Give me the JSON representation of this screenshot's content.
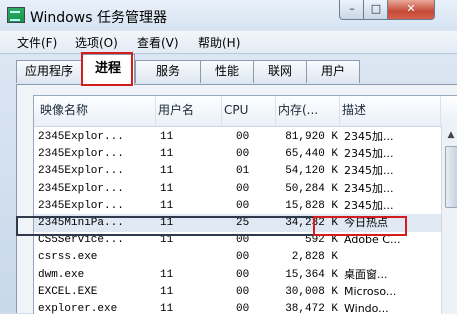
{
  "window": {
    "title": "Windows 任务管理器",
    "min_glyph": "–",
    "max_glyph": "□",
    "close_glyph": "✕"
  },
  "menu": [
    "文件(F)",
    "选项(O)",
    "查看(V)",
    "帮助(H)"
  ],
  "tabs": [
    "应用程序",
    "进程",
    "服务",
    "性能",
    "联网",
    "用户"
  ],
  "active_tab": "进程",
  "columns": [
    "映像名称",
    "用户名",
    "CPU",
    "内存(...",
    "描述"
  ],
  "rows": [
    {
      "image": "2345Explor...",
      "user": "11",
      "cpu": "00",
      "mem": "81,920 K",
      "desc": "2345加..."
    },
    {
      "image": "2345Explor...",
      "user": "11",
      "cpu": "00",
      "mem": "65,440 K",
      "desc": "2345加..."
    },
    {
      "image": "2345Explor...",
      "user": "11",
      "cpu": "01",
      "mem": "54,120 K",
      "desc": "2345加..."
    },
    {
      "image": "2345Explor...",
      "user": "11",
      "cpu": "00",
      "mem": "50,284 K",
      "desc": "2345加..."
    },
    {
      "image": "2345Explor...",
      "user": "11",
      "cpu": "00",
      "mem": "15,828 K",
      "desc": "2345加..."
    },
    {
      "image": "2345MiniPa...",
      "user": "11",
      "cpu": "25",
      "mem": "34,232 K",
      "desc": "今日热点"
    },
    {
      "image": "CS5Service...",
      "user": "11",
      "cpu": "00",
      "mem": "592 K",
      "desc": "Adobe C..."
    },
    {
      "image": "csrss.exe",
      "user": "",
      "cpu": "00",
      "mem": "2,828 K",
      "desc": ""
    },
    {
      "image": "dwm.exe",
      "user": "11",
      "cpu": "00",
      "mem": "15,364 K",
      "desc": "桌面窗..."
    },
    {
      "image": "EXCEL.EXE",
      "user": "11",
      "cpu": "00",
      "mem": "30,008 K",
      "desc": "Microso..."
    },
    {
      "image": "explorer.exe",
      "user": "11",
      "cpu": "00",
      "mem": "38,472 K",
      "desc": "Windo..."
    }
  ],
  "selected_row": 5,
  "scroll_up_glyph": "▲",
  "colors": {
    "highlight": "#d21e1e",
    "selected_row": "#dfe8f3"
  }
}
